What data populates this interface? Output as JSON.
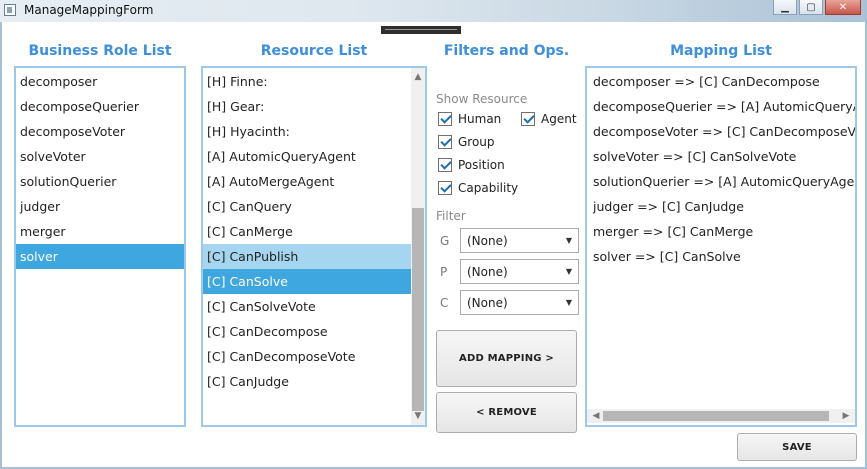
{
  "window": {
    "title": "ManageMappingForm"
  },
  "headers": {
    "business": "Business Role List",
    "resource": "Resource List",
    "filters": "Filters and Ops.",
    "mapping": "Mapping List"
  },
  "business_roles": [
    "decomposer",
    "decomposeQuerier",
    "decomposeVoter",
    "solveVoter",
    "solutionQuerier",
    "judger",
    "merger",
    "solver"
  ],
  "business_selected": "solver",
  "resources": [
    "[H] Finne:",
    "[H] Gear:",
    "[H] Hyacinth:",
    "[A] AutomicQueryAgent",
    "[A] AutoMergeAgent",
    "[C] CanQuery",
    "[C] CanMerge",
    "[C] CanPublish",
    "[C] CanSolve",
    "[C] CanSolveVote",
    "[C] CanDecompose",
    "[C] CanDecomposeVote",
    "[C] CanJudge"
  ],
  "resource_hover": "[C] CanPublish",
  "resource_selected": "[C] CanSolve",
  "filters": {
    "show_resource_label": "Show Resource",
    "checkboxes": {
      "human": {
        "label": "Human",
        "checked": true
      },
      "agent": {
        "label": "Agent",
        "checked": true
      },
      "group": {
        "label": "Group",
        "checked": true
      },
      "position": {
        "label": "Position",
        "checked": true
      },
      "capability": {
        "label": "Capability",
        "checked": true
      }
    },
    "filter_label": "Filter",
    "g": {
      "label": "G",
      "value": "(None)"
    },
    "p": {
      "label": "P",
      "value": "(None)"
    },
    "c": {
      "label": "C",
      "value": "(None)"
    }
  },
  "buttons": {
    "add_mapping": "ADD MAPPING >",
    "remove": "< REMOVE",
    "save": "SAVE"
  },
  "mappings": [
    "decomposer => [C] CanDecompose",
    "decomposeQuerier => [A] AutomicQueryAgent",
    "decomposeVoter => [C] CanDecomposeVote",
    "solveVoter => [C] CanSolveVote",
    "solutionQuerier => [A] AutomicQueryAgent",
    "judger => [C] CanJudge",
    "merger => [C] CanMerge",
    "solver => [C] CanSolve"
  ],
  "icons": {
    "minimize": "minimize-icon",
    "maximize": "maximize-icon",
    "close": "close-icon",
    "dropdown": "chevron-down-icon"
  },
  "colors": {
    "header": "#3c8fdc",
    "selected": "#3fa7e0",
    "hover": "#a6d6ef",
    "list_border": "#9dc8ea"
  }
}
